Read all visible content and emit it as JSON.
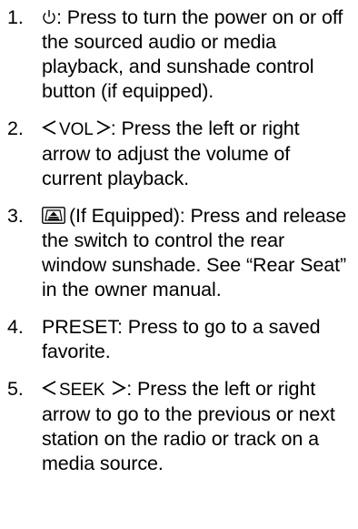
{
  "items": [
    {
      "number": "1.",
      "icon": "power-icon",
      "text": ": Press to turn the power on or off the sourced audio or media playback, and sunshade control button (if equipped)."
    },
    {
      "number": "2.",
      "icon": "volume-arrows",
      "label": "VOL",
      "text": ": Press the left or right arrow to adjust the volume of current playback."
    },
    {
      "number": "3.",
      "icon": "rear-sunshade-icon",
      "text": "(If Equipped): Press and release the switch to control the rear window sunshade. See “Rear Seat” in the owner manual."
    },
    {
      "number": "4.",
      "text": "PRESET: Press to go to a saved favorite."
    },
    {
      "number": "5.",
      "icon": "seek-arrows",
      "label": "SEEK",
      "text": ": Press the left or right arrow to go to the previous or next station on the radio or track on a media source."
    }
  ]
}
